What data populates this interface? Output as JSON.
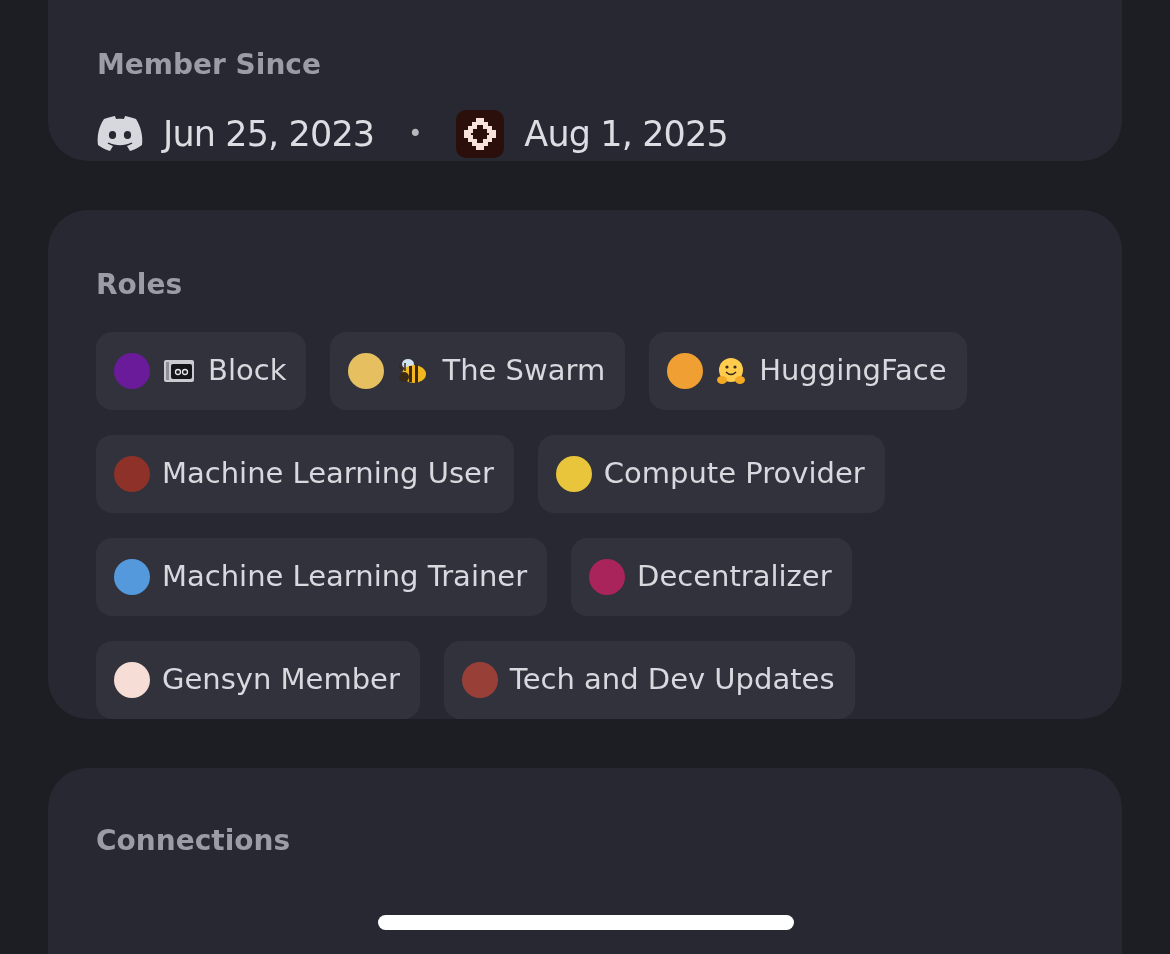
{
  "member_since": {
    "title": "Member Since",
    "discord_date": "Jun 25, 2023",
    "separator": "•",
    "server_date": "Aug 1, 2025"
  },
  "roles": {
    "title": "Roles",
    "items": [
      {
        "name": "Block",
        "color": "#6a1b9a",
        "kind": "robot"
      },
      {
        "name": "The Swarm",
        "color": "#e6c060",
        "kind": "bee"
      },
      {
        "name": "HuggingFace",
        "color": "#f0a032",
        "kind": "hug"
      },
      {
        "name": "Machine Learning User",
        "color": "#8e3128",
        "kind": "plain"
      },
      {
        "name": "Compute Provider",
        "color": "#e8c53a",
        "kind": "plain"
      },
      {
        "name": "Machine Learning Trainer",
        "color": "#5499dc",
        "kind": "plain"
      },
      {
        "name": "Decentralizer",
        "color": "#a8245a",
        "kind": "plain"
      },
      {
        "name": "Gensyn Member",
        "color": "#f6ddd6",
        "kind": "plain"
      },
      {
        "name": "Tech and Dev Updates",
        "color": "#984038",
        "kind": "plain"
      }
    ]
  },
  "connections": {
    "title": "Connections"
  }
}
